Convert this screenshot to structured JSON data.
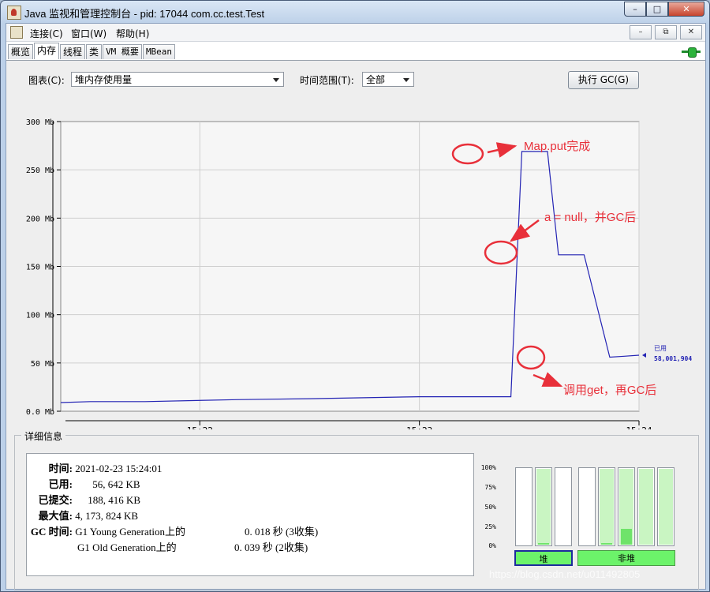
{
  "window": {
    "title": "Java 监视和管理控制台 - pid: 17044 com.cc.test.Test",
    "controls": {
      "minimize": "–",
      "maximize": "□",
      "close": "✕"
    }
  },
  "menu": {
    "items": [
      "连接(C)",
      "窗口(W)",
      "帮助(H)"
    ],
    "inner_controls": [
      "–",
      "⧉",
      "✕"
    ]
  },
  "tabs": [
    "概览",
    "内存",
    "线程",
    "类",
    "VM 概要",
    "MBean"
  ],
  "active_tab": "内存",
  "toolbar": {
    "chart_label": "图表(C):",
    "chart_value": "堆内存使用量",
    "time_label": "时间范围(T):",
    "time_value": "全部",
    "gc_button": "执行 GC(G)"
  },
  "chart_data": {
    "type": "line",
    "y_ticks": [
      "300 Mb",
      "250 Mb",
      "200 Mb",
      "150 Mb",
      "100 Mb",
      "50 Mb",
      "0.0 Mb"
    ],
    "ylim": [
      0,
      300
    ],
    "x_ticks": [
      "15:22",
      "15:23",
      "15:24"
    ],
    "xlim": [
      "15:21:22",
      "15:24:00"
    ],
    "series": [
      {
        "x": [
          "15:21:22",
          "15:21:30",
          "15:21:45",
          "15:22:10",
          "15:22:30",
          "15:23:00",
          "15:23:10",
          "15:23:25",
          "15:23:28",
          "15:23:35",
          "15:23:38",
          "15:23:45",
          "15:23:52",
          "15:23:56",
          "15:24:00"
        ],
        "y": [
          9,
          10,
          10,
          12,
          13,
          15,
          15,
          15,
          269,
          269,
          162,
          162,
          56,
          57,
          58
        ]
      }
    ],
    "current_label": "已用",
    "current_value": "58,001,904",
    "color": "#2424b4",
    "grid": true
  },
  "annotations": [
    {
      "text": "Map.put完成",
      "color": "#e8303a"
    },
    {
      "text": "a = null，并GC后",
      "color": "#e8303a"
    },
    {
      "text": "调用get，再GC后",
      "color": "#e8303a"
    }
  ],
  "details": {
    "title": "详细信息",
    "time_key": "时间:",
    "time_val": "2021-02-23 15:24:01",
    "used_key": "已用:",
    "used_val": "56, 642 KB",
    "committed_key": "已提交:",
    "committed_val": "188, 416 KB",
    "max_key": "最大值:",
    "max_val": "4, 173, 824 KB",
    "gc_key": "GC 时间:",
    "gc1_name": "G1 Young Generation上的",
    "gc1_val": "0. 018 秒 (3收集)",
    "gc2_name": "G1 Old Generation上的",
    "gc2_val": "0. 039 秒 (2收集)"
  },
  "pool_bars": {
    "pct_ticks": [
      "100%",
      "75%",
      "50%",
      "25%",
      "0%"
    ],
    "heap_fill": [
      0.0,
      1.0,
      0.0
    ],
    "heap_used": [
      0.0,
      0.02,
      0.0
    ],
    "nonheap_fill": [
      0.0,
      1.0,
      1.0,
      1.0,
      1.0
    ],
    "nonheap_used": [
      0.0,
      0.02,
      0.21,
      0.0,
      0.0
    ],
    "heap_label": "堆",
    "nonheap_label": "非堆",
    "accent": "#6cf36a"
  },
  "watermark": "https://blog.csdn.net/u011492805"
}
